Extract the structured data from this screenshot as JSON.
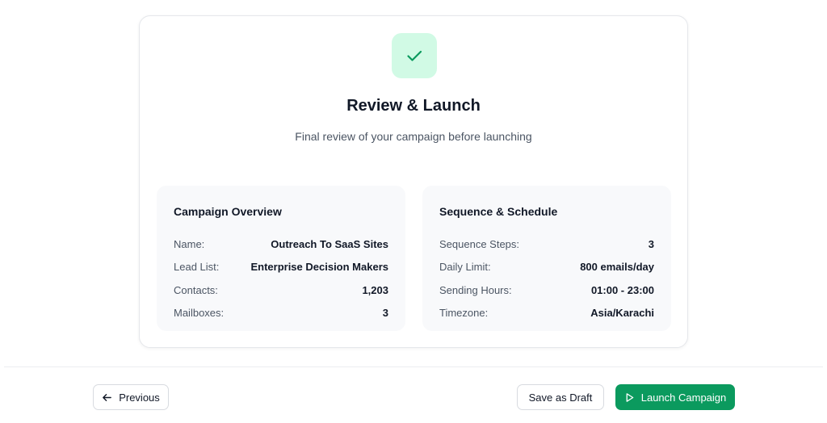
{
  "header": {
    "icon": "check-icon",
    "title": "Review & Launch",
    "subtitle": "Final review of your campaign before launching"
  },
  "overview": {
    "title": "Campaign Overview",
    "rows": [
      {
        "label": "Name:",
        "value": "Outreach To SaaS Sites"
      },
      {
        "label": "Lead List:",
        "value": "Enterprise Decision Makers"
      },
      {
        "label": "Contacts:",
        "value": "1,203"
      },
      {
        "label": "Mailboxes:",
        "value": "3"
      }
    ]
  },
  "schedule": {
    "title": "Sequence & Schedule",
    "rows": [
      {
        "label": "Sequence Steps:",
        "value": "3"
      },
      {
        "label": "Daily Limit:",
        "value": "800 emails/day"
      },
      {
        "label": "Sending Hours:",
        "value": "01:00 - 23:00"
      },
      {
        "label": "Timezone:",
        "value": "Asia/Karachi"
      }
    ]
  },
  "footer": {
    "previous_label": "Previous",
    "previous_icon": "arrow-left-icon",
    "draft_label": "Save as Draft",
    "launch_label": "Launch Campaign",
    "launch_icon": "play-icon"
  },
  "colors": {
    "accent": "#0b9a5e",
    "badge_bg": "#d1fae5",
    "panel_bg": "#f8f9fb"
  }
}
